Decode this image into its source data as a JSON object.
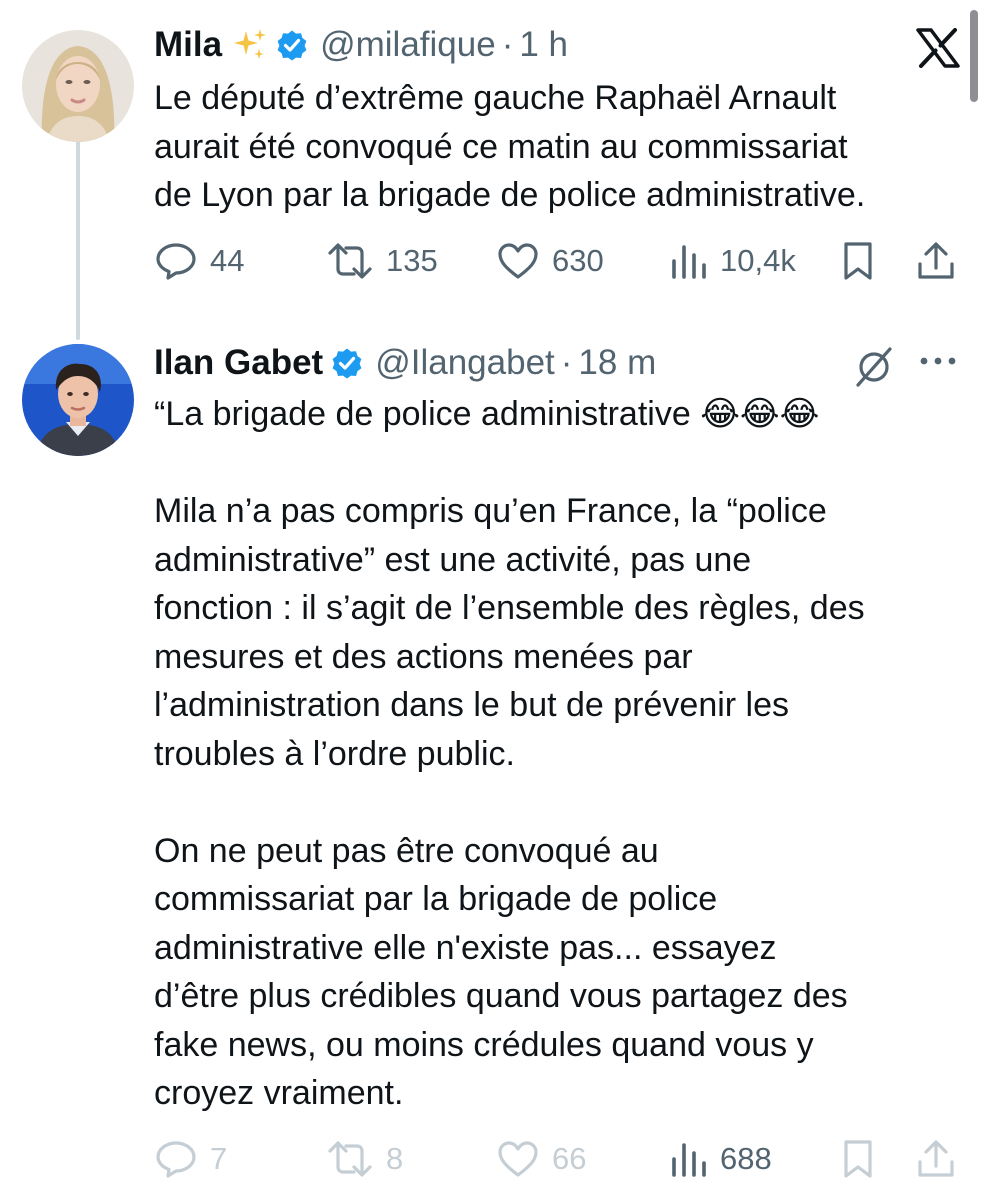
{
  "tweets": [
    {
      "author_name": "Mila",
      "handle": "@milafique",
      "separator": "·",
      "time": "1 h",
      "text": "Le député d’extrême gauche Raphaël Arnault\naurait été convoqué ce matin au commissariat\nde Lyon par la brigade de police administrative.",
      "replies": "44",
      "retweets": "135",
      "likes": "630",
      "views": "10,4k"
    },
    {
      "author_name": "Ilan Gabet",
      "handle": "@Ilangabet",
      "separator": "·",
      "time": "18 m",
      "text": "“La brigade de police administrative 😂😂😂\n\nMila n’a pas compris qu’en France, la “police\nadministrative” est une activité, pas une\nfonction : il s’agit de l’ensemble des règles, des\nmesures et des actions menées par\nl’administration dans le but de prévenir les\ntroubles à l’ordre public.\n\nOn ne peut pas être convoqué au\ncommissariat par la brigade de police\nadministrative elle n'existe pas... essayez\nd’être plus crédibles quand vous partagez des\nfake news, ou moins crédules quand vous y\ncroyez vraiment.",
      "replies": "7",
      "retweets": "8",
      "likes": "66",
      "views": "688"
    }
  ],
  "icons": {
    "app_logo": "x-logo-icon",
    "verified": "verified-badge-icon",
    "sparkles": "sparkles-icon",
    "reply": "reply-icon",
    "retweet": "retweet-icon",
    "like": "heart-icon",
    "views": "views-bar-icon",
    "bookmark": "bookmark-icon",
    "share": "share-icon",
    "grok": "grok-icon",
    "more": "more-dots-icon"
  },
  "colors": {
    "text": "#0f1419",
    "secondary": "#536471",
    "verified": "#1d9bf0",
    "faded": "#c5ced4",
    "thread_line": "#cfd9de"
  }
}
